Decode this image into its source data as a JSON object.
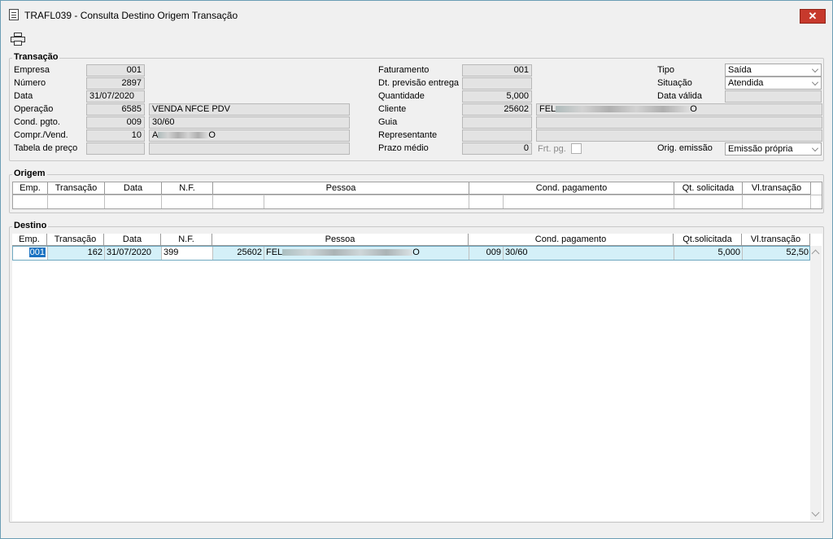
{
  "window": {
    "title": "TRAFL039 - Consulta Destino Origem Transação",
    "close_label": "✕"
  },
  "toolbar": {
    "print_icon": "printer-icon"
  },
  "transacao": {
    "title": "Transação",
    "empresa_label": "Empresa",
    "empresa": "001",
    "numero_label": "Número",
    "numero": "2897",
    "data_label": "Data",
    "data": "31/07/2020",
    "operacao_label": "Operação",
    "operacao": "6585",
    "operacao_desc": "VENDA NFCE PDV",
    "cond_label": "Cond. pgto.",
    "cond": "009",
    "cond_desc": "30/60",
    "compr_label": "Compr./Vend.",
    "compr": "10",
    "compr_desc_start": "A",
    "compr_desc_end": "O",
    "tabela_label": "Tabela de preço",
    "tabela": "",
    "tabela_desc": "",
    "faturamento_label": "Faturamento",
    "faturamento": "001",
    "dt_previsao_label": "Dt. previsão entrega",
    "dt_previsao": "",
    "quantidade_label": "Quantidade",
    "quantidade": "5,000",
    "cliente_label": "Cliente",
    "cliente": "25602",
    "cliente_desc_start": "FEL",
    "cliente_desc_end": "O",
    "guia_label": "Guia",
    "guia": "",
    "guia_desc": "",
    "representante_label": "Representante",
    "representante": "",
    "representante_desc": "",
    "prazo_label": "Prazo médio",
    "prazo": "0",
    "frt_label": "Frt. pg.",
    "tipo_label": "Tipo",
    "tipo": "Saída",
    "situacao_label": "Situação",
    "situacao": "Atendida",
    "data_valida_label": "Data válida",
    "data_valida": "",
    "orig_label": "Orig. emissão",
    "orig": "Emissão própria"
  },
  "columns": [
    "Emp.",
    "Transação",
    "Data",
    "N.F.",
    "Pessoa",
    "Cond. pagamento",
    "Qt. solicitada",
    "Vl.transação"
  ],
  "columns_destino": [
    "Emp.",
    "Transação",
    "Data",
    "N.F.",
    "Pessoa",
    "Cond. pagamento",
    "Qt.solicitada",
    "Vl.transação"
  ],
  "origem": {
    "title": "Origem"
  },
  "destino": {
    "title": "Destino",
    "row": {
      "emp": "001",
      "transacao": "162",
      "data": "31/07/2020",
      "nf": "399",
      "pessoa_cod": "25602",
      "pessoa_start": "FEL",
      "pessoa_end": "O",
      "cond_cod": "009",
      "cond_desc": "30/60",
      "qt": "5,000",
      "valor": "52,50"
    }
  }
}
